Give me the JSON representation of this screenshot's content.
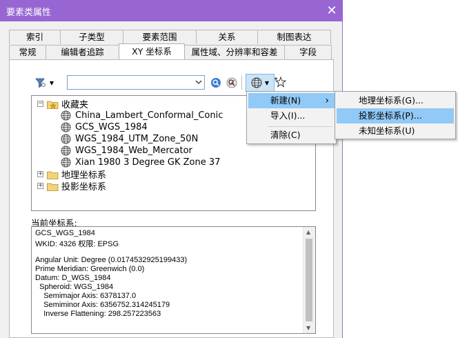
{
  "window": {
    "title": "要素类属性",
    "close_glyph": "✕"
  },
  "tabs": {
    "row1": [
      {
        "label": "索引"
      },
      {
        "label": "子类型"
      },
      {
        "label": "要素范围"
      },
      {
        "label": "关系"
      },
      {
        "label": "制图表达"
      }
    ],
    "row2": [
      {
        "label": "常规"
      },
      {
        "label": "编辑者追踪"
      },
      {
        "label": "XY 坐标系",
        "active": true
      },
      {
        "label": "属性域、分辨率和容差"
      },
      {
        "label": "字段"
      }
    ]
  },
  "toolbar": {
    "filter_icon": "filter-icon",
    "search_value": "",
    "search_icon": "search-icon",
    "clear_search_icon": "clear-search-icon",
    "globe_icon": "globe-icon",
    "add_favorite_icon": "star-add-icon"
  },
  "tree": {
    "favorites": {
      "label": "收藏夹",
      "expanded": true,
      "items": [
        {
          "label": "China_Lambert_Conformal_Conic"
        },
        {
          "label": "GCS_WGS_1984"
        },
        {
          "label": "WGS_1984_UTM_Zone_50N"
        },
        {
          "label": "WGS_1984_Web_Mercator"
        },
        {
          "label": "Xian 1980 3 Degree GK Zone 37"
        }
      ]
    },
    "geographic": {
      "label": "地理坐标系"
    },
    "projected": {
      "label": "投影坐标系"
    }
  },
  "current": {
    "label": "当前坐标系:",
    "lines": [
      "GCS_WGS_1984",
      "WKID: 4326 权限: EPSG",
      "",
      "Angular Unit: Degree (0.0174532925199433)",
      "Prime Meridian: Greenwich (0.0)",
      "Datum: D_WGS_1984",
      "  Spheroid: WGS_1984",
      "    Semimajor Axis: 6378137.0",
      "    Semiminor Axis: 6356752.314245179",
      "    Inverse Flattening: 298.257223563"
    ]
  },
  "context_menu": {
    "new_label": "新建(N)",
    "import_label": "导入(I)...",
    "clear_label": "清除(C)",
    "submenu_arrow": "›"
  },
  "submenu": {
    "geographic_label": "地理坐标系(G)...",
    "projected_label": "投影坐标系(P)...",
    "unknown_label": "未知坐标系(U)"
  },
  "colors": {
    "titlebar": "#9766d2",
    "highlight": "#91c9f7"
  }
}
